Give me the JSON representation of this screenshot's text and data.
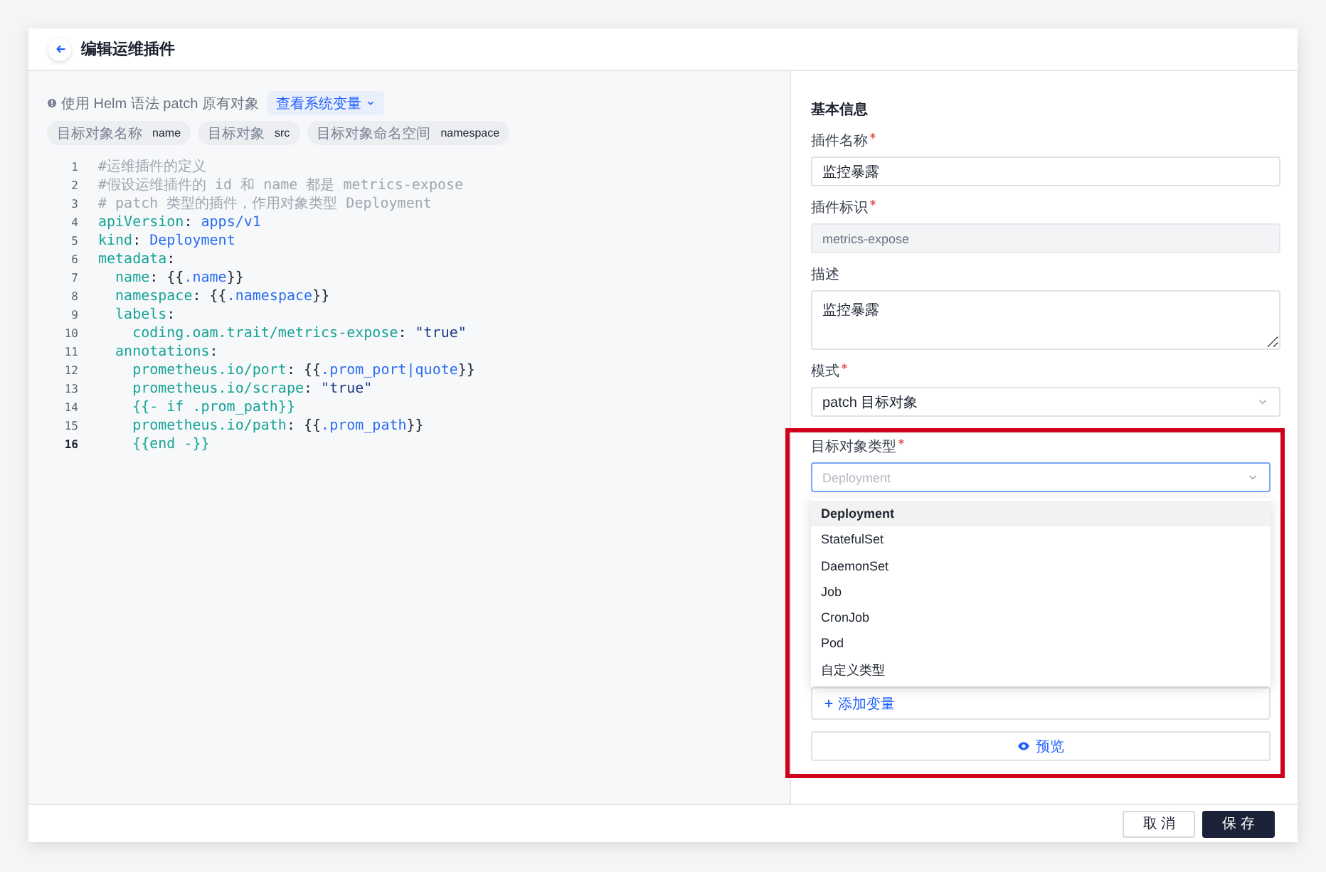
{
  "header": {
    "title": "编辑运维插件"
  },
  "hint": {
    "text": "使用 Helm 语法 patch 原有对象",
    "menu_button": "查看系统变量"
  },
  "variables": [
    {
      "label": "目标对象名称",
      "value": "name"
    },
    {
      "label": "目标对象",
      "value": "src"
    },
    {
      "label": "目标对象命名空间",
      "value": "namespace"
    }
  ],
  "code_lines": [
    {
      "number": "1",
      "current": false,
      "segments": [
        {
          "kind": "comment",
          "text": "#运维插件的定义"
        }
      ]
    },
    {
      "number": "2",
      "current": false,
      "segments": [
        {
          "kind": "comment",
          "text": "#假设运维插件的 id 和 name 都是 metrics-expose"
        }
      ]
    },
    {
      "number": "3",
      "current": false,
      "segments": [
        {
          "kind": "comment",
          "text": "# patch 类型的插件，作用对象类型 Deployment"
        }
      ]
    },
    {
      "number": "4",
      "current": false,
      "segments": [
        {
          "kind": "key",
          "text": "apiVersion"
        },
        {
          "kind": "punct",
          "text": ": "
        },
        {
          "kind": "value",
          "text": "apps/v1"
        }
      ]
    },
    {
      "number": "5",
      "current": false,
      "segments": [
        {
          "kind": "key",
          "text": "kind"
        },
        {
          "kind": "punct",
          "text": ": "
        },
        {
          "kind": "value",
          "text": "Deployment"
        }
      ]
    },
    {
      "number": "6",
      "current": false,
      "segments": [
        {
          "kind": "key",
          "text": "metadata"
        },
        {
          "kind": "punct",
          "text": ":"
        }
      ]
    },
    {
      "number": "7",
      "current": false,
      "segments": [
        {
          "kind": "key",
          "text": "  name"
        },
        {
          "kind": "punct",
          "text": ": {{"
        },
        {
          "kind": "value",
          "text": ".name"
        },
        {
          "kind": "punct",
          "text": "}}"
        }
      ]
    },
    {
      "number": "8",
      "current": false,
      "segments": [
        {
          "kind": "key",
          "text": "  namespace"
        },
        {
          "kind": "punct",
          "text": ": {{"
        },
        {
          "kind": "value",
          "text": ".namespace"
        },
        {
          "kind": "punct",
          "text": "}}"
        }
      ]
    },
    {
      "number": "9",
      "current": false,
      "segments": [
        {
          "kind": "key",
          "text": "  labels"
        },
        {
          "kind": "punct",
          "text": ":"
        }
      ]
    },
    {
      "number": "10",
      "current": false,
      "segments": [
        {
          "kind": "key",
          "text": "    coding.oam.trait/metrics-expose"
        },
        {
          "kind": "punct",
          "text": ": "
        },
        {
          "kind": "string",
          "text": "\"true\""
        }
      ]
    },
    {
      "number": "11",
      "current": false,
      "segments": [
        {
          "kind": "key",
          "text": "  annotations"
        },
        {
          "kind": "punct",
          "text": ":"
        }
      ]
    },
    {
      "number": "12",
      "current": false,
      "segments": [
        {
          "kind": "key",
          "text": "    prometheus.io/port"
        },
        {
          "kind": "punct",
          "text": ": {{"
        },
        {
          "kind": "value",
          "text": ".prom_port|quote"
        },
        {
          "kind": "punct",
          "text": "}}"
        }
      ]
    },
    {
      "number": "13",
      "current": false,
      "segments": [
        {
          "kind": "key",
          "text": "    prometheus.io/scrape"
        },
        {
          "kind": "punct",
          "text": ": "
        },
        {
          "kind": "string",
          "text": "\"true\""
        }
      ]
    },
    {
      "number": "14",
      "current": false,
      "segments": [
        {
          "kind": "key",
          "text": "    {{- if .prom_path}}"
        }
      ]
    },
    {
      "number": "15",
      "current": false,
      "segments": [
        {
          "kind": "key",
          "text": "    prometheus.io/path"
        },
        {
          "kind": "punct",
          "text": ": {{"
        },
        {
          "kind": "value",
          "text": ".prom_path"
        },
        {
          "kind": "punct",
          "text": "}}"
        }
      ]
    },
    {
      "number": "16",
      "current": true,
      "segments": [
        {
          "kind": "key",
          "text": "    {{end -}}"
        }
      ]
    }
  ],
  "form": {
    "section_title": "基本信息",
    "fields": [
      {
        "kind": "input",
        "label": "插件名称",
        "required": true,
        "value": "监控暴露",
        "disabled": false
      },
      {
        "kind": "input",
        "label": "插件标识",
        "required": true,
        "value": "metrics-expose",
        "disabled": true
      },
      {
        "kind": "textarea",
        "label": "描述",
        "required": false,
        "value": "监控暴露"
      },
      {
        "kind": "select",
        "label": "模式",
        "required": true,
        "value": "patch 目标对象"
      }
    ],
    "target_type": {
      "label": "目标对象类型",
      "required": true,
      "placeholder": "Deployment",
      "focused": true,
      "options": [
        {
          "label": "Deployment",
          "selected": true
        },
        {
          "label": "StatefulSet",
          "selected": false
        },
        {
          "label": "DaemonSet",
          "selected": false
        },
        {
          "label": "Job",
          "selected": false
        },
        {
          "label": "CronJob",
          "selected": false
        },
        {
          "label": "Pod",
          "selected": false
        },
        {
          "label": "自定义类型",
          "selected": false
        }
      ]
    },
    "add_variable": "添加变量",
    "preview_button": "预览"
  },
  "footer": {
    "buttons": [
      {
        "label": "取 消",
        "kind": "secondary"
      },
      {
        "label": "保 存",
        "kind": "primary"
      }
    ]
  }
}
